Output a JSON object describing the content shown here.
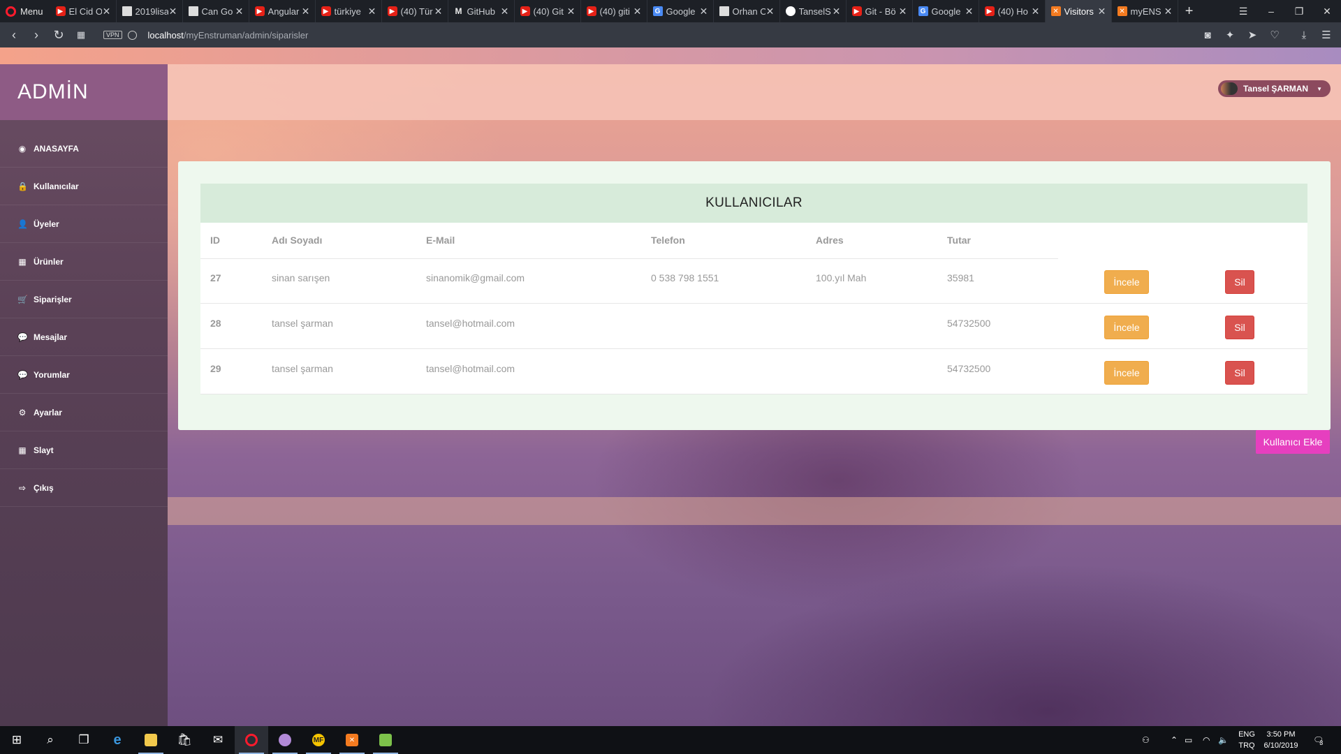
{
  "browser": {
    "menu_label": "Menu",
    "tabs": [
      {
        "title": "El Cid O",
        "favicon": "youtube-icon"
      },
      {
        "title": "2019lisa",
        "favicon": "document-icon"
      },
      {
        "title": "Can Go",
        "favicon": "document-icon"
      },
      {
        "title": "Angular",
        "favicon": "youtube-icon"
      },
      {
        "title": "türkiye",
        "favicon": "youtube-icon"
      },
      {
        "title": "(40) Tür",
        "favicon": "youtube-icon"
      },
      {
        "title": "GitHub",
        "favicon": "gmail-icon"
      },
      {
        "title": "(40) Git",
        "favicon": "youtube-icon"
      },
      {
        "title": "(40) giti",
        "favicon": "youtube-icon"
      },
      {
        "title": "Google",
        "favicon": "translate-icon"
      },
      {
        "title": "Orhan O",
        "favicon": "document-icon"
      },
      {
        "title": "TanselS",
        "favicon": "github-icon"
      },
      {
        "title": "Git - Bö",
        "favicon": "youtube-icon"
      },
      {
        "title": "Google",
        "favicon": "translate-icon"
      },
      {
        "title": "(40) Ho",
        "favicon": "youtube-icon"
      },
      {
        "title": "Visitors",
        "favicon": "xampp-icon",
        "active": true
      },
      {
        "title": "myENS",
        "favicon": "xampp-icon"
      }
    ],
    "url_host": "localhost",
    "url_path": "/myEnstruman/admin/siparisler",
    "vpn_label": "VPN"
  },
  "sidebar": {
    "brand": "ADMİN",
    "items": [
      {
        "label": "ANASAYFA",
        "icon": "dashboard-icon",
        "glyph": "◉"
      },
      {
        "label": "Kullanıcılar",
        "icon": "lock-icon",
        "glyph": "🔒"
      },
      {
        "label": "Üyeler",
        "icon": "user-icon",
        "glyph": "👤"
      },
      {
        "label": "Ürünler",
        "icon": "grid-icon",
        "glyph": "▦"
      },
      {
        "label": "Siparişler",
        "icon": "cart-icon",
        "glyph": "🛒"
      },
      {
        "label": "Mesajlar",
        "icon": "comment-icon",
        "glyph": "💬"
      },
      {
        "label": "Yorumlar",
        "icon": "comment-icon",
        "glyph": "💬"
      },
      {
        "label": "Ayarlar",
        "icon": "gear-icon",
        "glyph": "⚙"
      },
      {
        "label": "Slayt",
        "icon": "grid-icon",
        "glyph": "▦"
      },
      {
        "label": "Çıkış",
        "icon": "signout-icon",
        "glyph": "⇨"
      }
    ]
  },
  "header": {
    "user_name": "Tansel ŞARMAN"
  },
  "table": {
    "title": "KULLANICILAR",
    "columns": [
      "ID",
      "Adı Soyadı",
      "E-Mail",
      "Telefon",
      "Adres",
      "Tutar"
    ],
    "rows": [
      {
        "id": "27",
        "name": "sinan sarışen",
        "email": "sinanomik@gmail.com",
        "phone": "0 538 798 1551",
        "address": "100.yıl Mah",
        "amount": "35981"
      },
      {
        "id": "28",
        "name": "tansel şarman",
        "email": "tansel@hotmail.com",
        "phone": "",
        "address": "",
        "amount": "54732500"
      },
      {
        "id": "29",
        "name": "tansel şarman",
        "email": "tansel@hotmail.com",
        "phone": "",
        "address": "",
        "amount": "54732500"
      }
    ],
    "inspect_label": "İncele",
    "delete_label": "Sil"
  },
  "add_user_label": "Kullanıcı Ekle",
  "taskbar": {
    "lang_top": "ENG",
    "lang_bottom": "TRQ",
    "time": "3:50 PM",
    "date": "6/10/2019",
    "notifications": "3"
  }
}
